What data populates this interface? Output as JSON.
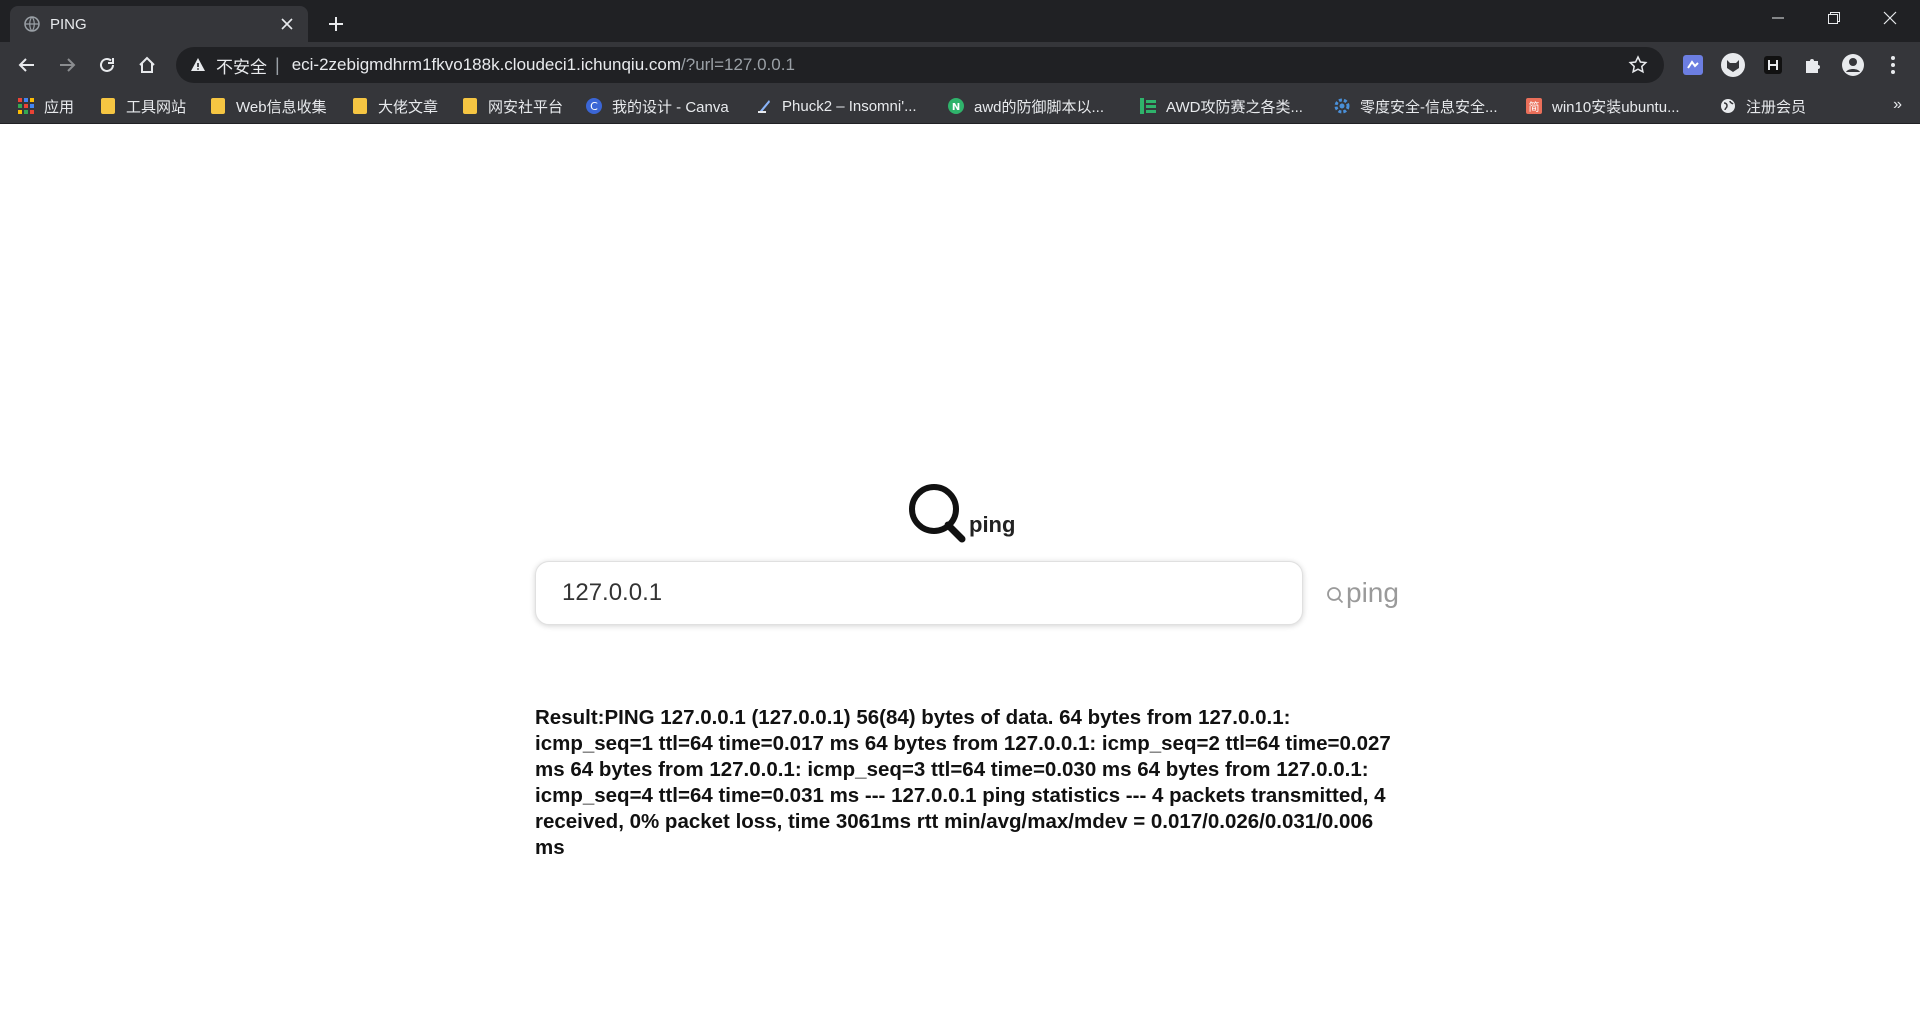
{
  "browser": {
    "tab": {
      "title": "PING",
      "close_glyph": "✕"
    },
    "new_tab_glyph": "+",
    "omnibox": {
      "security_label": "不安全",
      "separator": "|",
      "url_host": "eci-2zebigmdhrm1fkvo188k.cloudeci1.ichunqiu.com",
      "url_path": "/?url=127.0.0.1"
    },
    "bookmarks": [
      {
        "label": "应用",
        "icon": "apps-grid-icon"
      },
      {
        "label": "工具网站",
        "icon": "folder-icon"
      },
      {
        "label": "Web信息收集",
        "icon": "folder-icon"
      },
      {
        "label": "大佬文章",
        "icon": "folder-icon"
      },
      {
        "label": "网安社平台",
        "icon": "folder-icon"
      },
      {
        "label": "我的设计 - Canva",
        "icon": "canva-icon"
      },
      {
        "label": "Phuck2 – Insomni'...",
        "icon": "page-icon"
      },
      {
        "label": "awd的防御脚本以...",
        "icon": "n-circle-icon"
      },
      {
        "label": "AWD攻防赛之各类...",
        "icon": "green-bars-icon"
      },
      {
        "label": "零度安全-信息安全...",
        "icon": "gear-site-icon"
      },
      {
        "label": "win10安装ubuntu...",
        "icon": "jianshu-icon"
      },
      {
        "label": "注册会员",
        "icon": "globe-icon"
      }
    ],
    "bookmarks_more": "»"
  },
  "page": {
    "logo_text": "ping",
    "search": {
      "value": "127.0.0.1"
    },
    "search_button_label": "ping",
    "result_text": "Result:PING 127.0.0.1 (127.0.0.1) 56(84) bytes of data. 64 bytes from 127.0.0.1: icmp_seq=1 ttl=64 time=0.017 ms 64 bytes from 127.0.0.1: icmp_seq=2 ttl=64 time=0.027 ms 64 bytes from 127.0.0.1: icmp_seq=3 ttl=64 time=0.030 ms 64 bytes from 127.0.0.1: icmp_seq=4 ttl=64 time=0.031 ms --- 127.0.0.1 ping statistics --- 4 packets transmitted, 4 received, 0% packet loss, time 3061ms rtt min/avg/max/mdev = 0.017/0.026/0.031/0.006 ms"
  },
  "colors": {
    "chrome_dark": "#202124",
    "chrome_toolbar": "#35363a",
    "chrome_text": "#e8eaed",
    "folder": "#f5c542"
  }
}
